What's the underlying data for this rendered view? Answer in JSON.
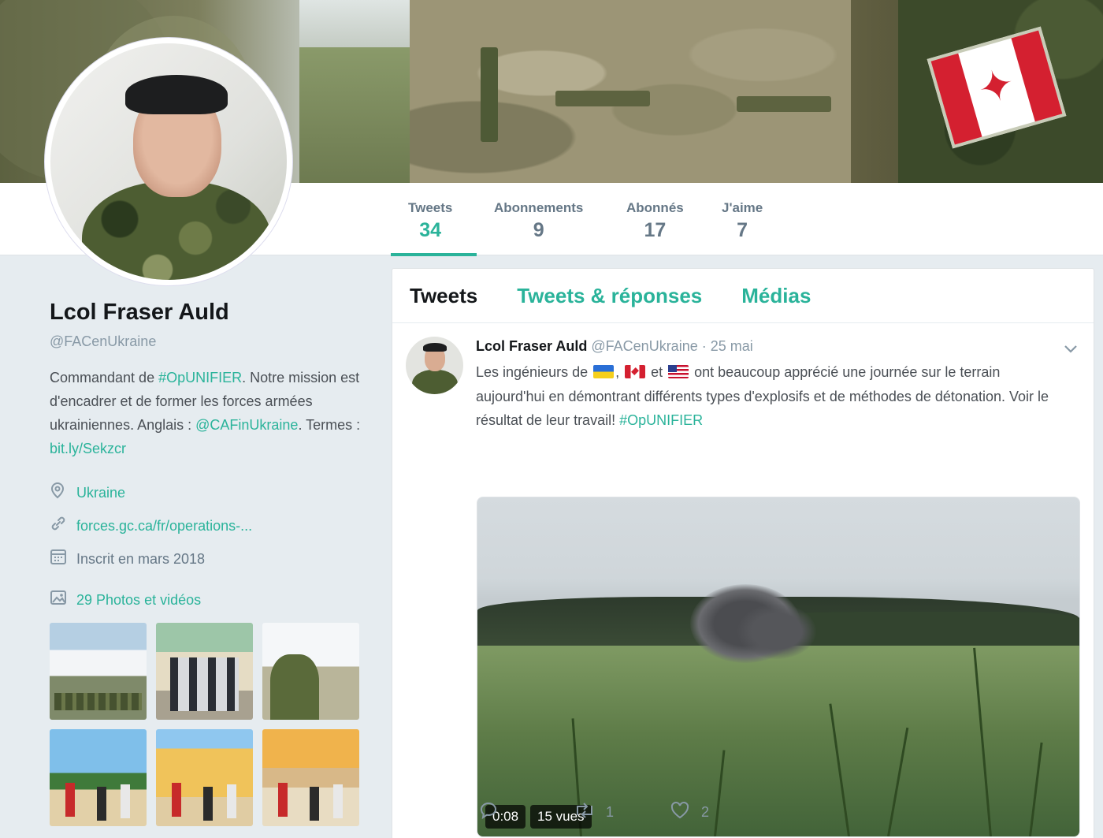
{
  "profile": {
    "name": "Lcol Fraser Auld",
    "handle": "@FACenUkraine",
    "bio_prefix": "Commandant de ",
    "bio_hashtag": "#OpUNIFIER",
    "bio_middle": ". Notre mission est d'encadrer et de former les forces armées ukrainiennes. Anglais : ",
    "bio_mention": "@CAFinUkraine",
    "bio_terms": ". Termes : ",
    "bio_link": "bit.ly/Sekzcr",
    "location": "Ukraine",
    "website": "forces.gc.ca/fr/operations-...",
    "joined": "Inscrit en mars 2018",
    "photos_label": "29 Photos et vidéos"
  },
  "stats": [
    {
      "label": "Tweets",
      "value": "34"
    },
    {
      "label": "Abonnements",
      "value": "9"
    },
    {
      "label": "Abonnés",
      "value": "17"
    },
    {
      "label": "J'aime",
      "value": "7"
    }
  ],
  "tabs": [
    "Tweets",
    "Tweets & réponses",
    "Médias"
  ],
  "tweet": {
    "name": "Lcol Fraser Auld",
    "handle": "@FACenUkraine",
    "date": " · 25 mai",
    "text_1": "Les ingénieurs de ",
    "sep_1": ", ",
    "sep_2": " et ",
    "text_2": " ont beaucoup apprécié une journée sur le terrain aujourd'hui en démontrant différents types d'explosifs et de méthodes de détonation. Voir le résultat de leur travail! ",
    "hashtag": "#OpUNIFIER",
    "video_duration": "0:08",
    "video_views": "15 vues",
    "retweets": "1",
    "likes": "2"
  },
  "colors": {
    "accent": "#2ab39a",
    "muted": "#657786",
    "background": "#e6ecf0"
  },
  "icons": [
    "location-pin-icon",
    "link-icon",
    "calendar-icon",
    "photo-icon",
    "chevron-down-icon",
    "reply-icon",
    "retweet-icon",
    "heart-icon"
  ]
}
